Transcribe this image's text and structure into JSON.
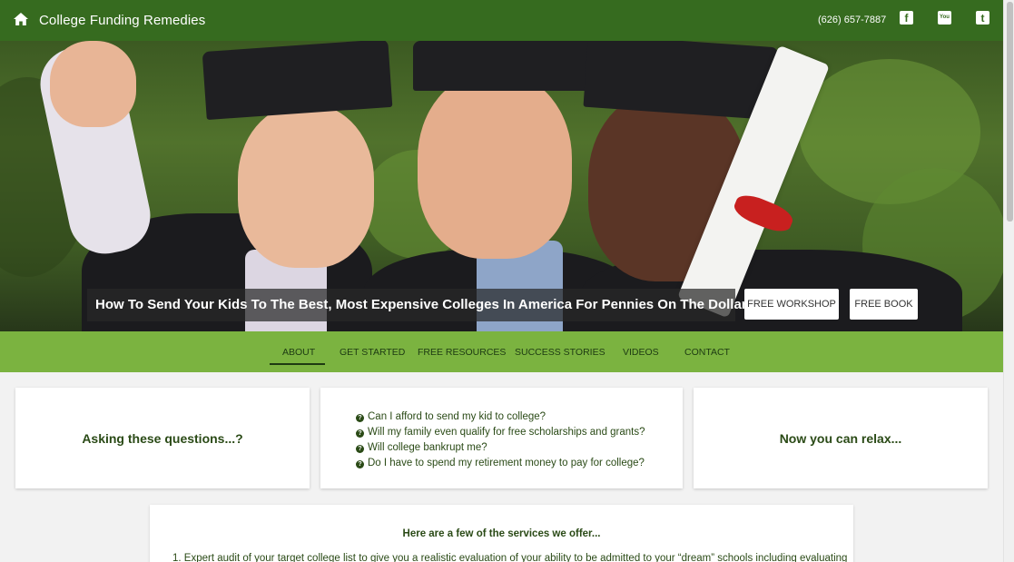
{
  "topbar": {
    "home_icon": "home-icon",
    "brand": "College Funding Remedies",
    "phone": "(626) 657-7887",
    "social": [
      {
        "icon": "facebook-icon",
        "glyph": "f"
      },
      {
        "icon": "youtube-icon",
        "glyph": "You"
      },
      {
        "icon": "twitter-icon",
        "glyph": "t"
      }
    ],
    "bg_color": "#366b1f"
  },
  "hero": {
    "tagline": "How To Send Your Kids To The Best, Most Expensive Colleges In America For Pennies On The Dollar!",
    "buttons": {
      "workshop": "FREE WORKSHOP",
      "book": "FREE BOOK"
    }
  },
  "nav": {
    "bg_color": "#7bb340",
    "items": [
      {
        "label": "ABOUT",
        "active": true
      },
      {
        "label": "GET STARTED"
      },
      {
        "label": "FREE RESOURCES"
      },
      {
        "label": "SUCCESS STORIES"
      },
      {
        "label": "VIDEOS"
      },
      {
        "label": "CONTACT"
      }
    ]
  },
  "cards": {
    "left_heading": "Asking these questions...?",
    "questions": [
      "Can I afford to send my kid to college?",
      "Will my family even qualify for free scholarships and grants?",
      "Will college bankrupt me?",
      "Do I have to spend my retirement money to pay for college?"
    ],
    "question_icon": "question-circle-icon",
    "right_heading": "Now you can relax..."
  },
  "services": {
    "heading": "Here are a few of the services we offer...",
    "first_item": "1.   Expert audit of your target college list to give you a realistic evaluation of your ability to be admitted to your “dream” schools including evaluating"
  }
}
